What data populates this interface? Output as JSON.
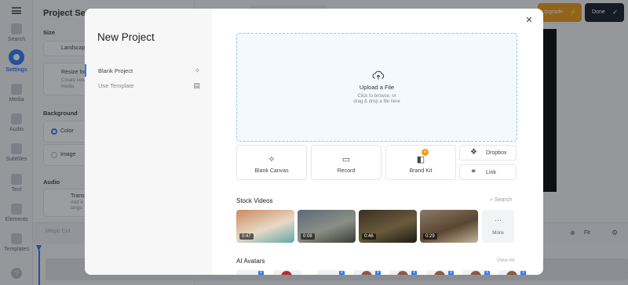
{
  "app": {
    "rail": [
      {
        "label": "Search",
        "icon": "search-icon"
      },
      {
        "label": "Settings",
        "icon": "settings-icon",
        "active": true
      },
      {
        "label": "Media",
        "icon": "plus-icon"
      },
      {
        "label": "Audio",
        "icon": "music-icon"
      },
      {
        "label": "Subtitles",
        "icon": "subtitles-icon"
      },
      {
        "label": "Text",
        "icon": "text-icon"
      },
      {
        "label": "Elements",
        "icon": "shapes-icon"
      },
      {
        "label": "Templates",
        "icon": "templates-icon"
      }
    ],
    "panel": {
      "title": "Project Settings",
      "size_head": "Size",
      "landscape": "Landscape",
      "resize_title": "Resize for",
      "resize_sub1": "Create new",
      "resize_sub2": "media",
      "background_head": "Background",
      "color_label": "Color",
      "image_label": "Image",
      "audio_head": "Audio",
      "trans_title": "Trans",
      "trans_sub1": "Add v",
      "trans_sub2": "langu"
    },
    "upgrade_label": "Upgrade",
    "done_label": "Done",
    "magic_cut": "Magic Cut",
    "fit_label": "Fit"
  },
  "modal": {
    "title": "New Project",
    "nav": [
      {
        "label": "Blank Project",
        "icon": "sparkle-icon",
        "active": true
      },
      {
        "label": "Use Template",
        "icon": "template-icon",
        "active": false
      }
    ],
    "upload": {
      "title": "Upload a File",
      "sub1": "Click to browse, or",
      "sub2": "drag & drop a file here"
    },
    "tiles": [
      {
        "label": "Blank Canvas",
        "icon": "sparkle-icon"
      },
      {
        "label": "Record",
        "icon": "camera-icon"
      },
      {
        "label": "Brand Kit",
        "icon": "brand-kit-icon"
      }
    ],
    "mini": [
      {
        "label": "Dropbox",
        "icon": "dropbox-icon"
      },
      {
        "label": "Link",
        "icon": "link-icon"
      }
    ],
    "stock_title": "Stock Videos",
    "search_label": "Search",
    "videos": [
      {
        "duration": "0:47",
        "colors": [
          "#c98a63",
          "#e8d9c4",
          "#5fa9a8"
        ]
      },
      {
        "duration": "0:08",
        "colors": [
          "#5c6a78",
          "#8a8f86",
          "#3b3d35"
        ]
      },
      {
        "duration": "0:46",
        "colors": [
          "#3a3022",
          "#6a5a3c",
          "#1f1a14"
        ]
      },
      {
        "duration": "0:29",
        "colors": [
          "#8a7a66",
          "#5a4632",
          "#c2b49a"
        ]
      }
    ],
    "more_label": "More",
    "avatars_title": "AI Avatars",
    "view_all": "View All"
  }
}
